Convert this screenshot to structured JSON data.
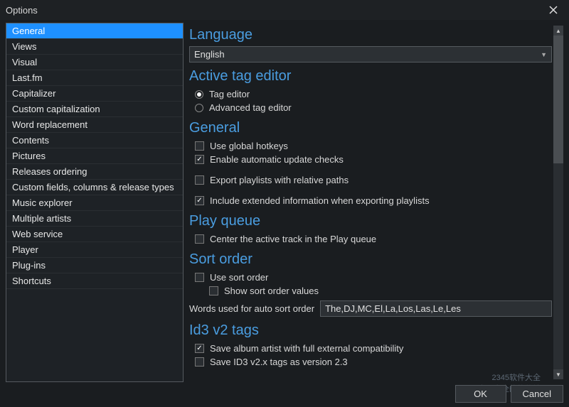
{
  "window": {
    "title": "Options",
    "close_label": "Close"
  },
  "sidebar": {
    "items": [
      {
        "label": "General",
        "selected": true
      },
      {
        "label": "Views"
      },
      {
        "label": "Visual"
      },
      {
        "label": "Last.fm"
      },
      {
        "label": "Capitalizer"
      },
      {
        "label": "Custom capitalization"
      },
      {
        "label": "Word replacement"
      },
      {
        "label": "Contents"
      },
      {
        "label": "Pictures"
      },
      {
        "label": "Releases ordering"
      },
      {
        "label": "Custom fields, columns & release types"
      },
      {
        "label": "Music explorer"
      },
      {
        "label": "Multiple artists"
      },
      {
        "label": "Web service"
      },
      {
        "label": "Player"
      },
      {
        "label": "Plug-ins"
      },
      {
        "label": "Shortcuts"
      }
    ]
  },
  "sections": {
    "language": {
      "title": "Language",
      "value": "English"
    },
    "active_tag_editor": {
      "title": "Active tag editor",
      "option_tag_editor": "Tag editor",
      "option_advanced": "Advanced tag editor"
    },
    "general": {
      "title": "General",
      "use_global_hotkeys": "Use global hotkeys",
      "enable_update_checks": "Enable automatic update checks",
      "export_relative_paths": "Export playlists with relative paths",
      "include_extended_info": "Include extended information when exporting playlists"
    },
    "play_queue": {
      "title": "Play queue",
      "center_active_track": "Center the active track in the Play queue"
    },
    "sort_order": {
      "title": "Sort order",
      "use_sort_order": "Use sort order",
      "show_values": "Show sort order values",
      "words_label": "Words used for auto sort order",
      "words_value": "The,DJ,MC,El,La,Los,Las,Le,Les"
    },
    "id3v2": {
      "title": "Id3 v2 tags",
      "save_album_artist": "Save album artist with full external compatibility",
      "save_v23": "Save ID3 v2.x tags as version 2.3"
    }
  },
  "footer": {
    "ok": "OK",
    "cancel": "Cancel"
  },
  "watermark": {
    "line1": "2345软件大全",
    "line2": "国内更安全的软件站"
  }
}
